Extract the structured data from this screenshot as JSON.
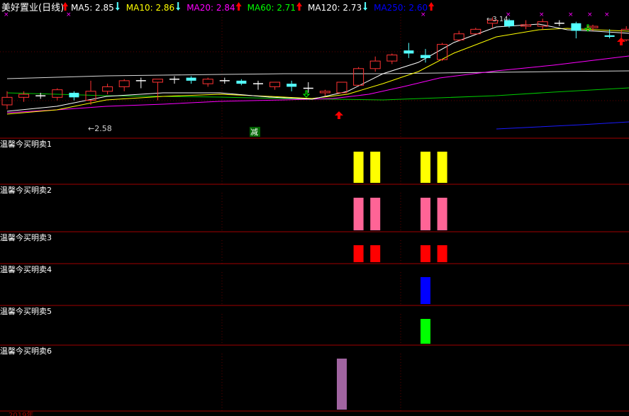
{
  "header": {
    "stock_name": "美好置业(日线)",
    "indicators": [
      {
        "label": "MA5: 2.85",
        "arrow": "down",
        "color": "#ffffff",
        "icon": "arrow-down-icon"
      },
      {
        "label": "MA10: 2.86",
        "arrow": "down",
        "color": "#ffff00",
        "icon": "arrow-down-icon"
      },
      {
        "label": "MA20: 2.84",
        "arrow": "up",
        "color": "#ff00ff",
        "icon": "arrow-up-icon"
      },
      {
        "label": "MA60: 2.71",
        "arrow": "up",
        "color": "#00ff00",
        "icon": "arrow-up-icon"
      },
      {
        "label": "MA120: 2.73",
        "arrow": "down",
        "color": "#ffffff",
        "icon": "arrow-down-icon"
      },
      {
        "label": "MA250: 2.60",
        "arrow": "up",
        "color": "#0000ff",
        "icon": "arrow-up-icon"
      }
    ]
  },
  "colors": {
    "background": "#000000",
    "panel_border": "#a00000",
    "up_candle": "#ff3232",
    "down_candle": "#54ffff",
    "doji": "#ffffff",
    "text": "#ffffff"
  },
  "chart_data": {
    "type": "candlestick",
    "price_range": [
      2.4,
      3.15
    ],
    "candles": [
      {
        "o": 2.55,
        "h": 2.64,
        "l": 2.52,
        "c": 2.6
      },
      {
        "o": 2.6,
        "h": 2.64,
        "l": 2.57,
        "c": 2.62
      },
      {
        "o": 2.61,
        "h": 2.63,
        "l": 2.59,
        "c": 2.61
      },
      {
        "o": 2.6,
        "h": 2.66,
        "l": 2.58,
        "c": 2.65
      },
      {
        "o": 2.63,
        "h": 2.64,
        "l": 2.58,
        "c": 2.6
      },
      {
        "o": 2.58,
        "h": 2.71,
        "l": 2.55,
        "c": 2.64
      },
      {
        "o": 2.64,
        "h": 2.69,
        "l": 2.62,
        "c": 2.67
      },
      {
        "o": 2.67,
        "h": 2.72,
        "l": 2.64,
        "c": 2.71
      },
      {
        "o": 2.71,
        "h": 2.73,
        "l": 2.66,
        "c": 2.71
      },
      {
        "o": 2.7,
        "h": 2.72,
        "l": 2.58,
        "c": 2.72
      },
      {
        "o": 2.72,
        "h": 2.74,
        "l": 2.69,
        "c": 2.72
      },
      {
        "o": 2.73,
        "h": 2.74,
        "l": 2.69,
        "c": 2.71
      },
      {
        "o": 2.69,
        "h": 2.73,
        "l": 2.67,
        "c": 2.72
      },
      {
        "o": 2.71,
        "h": 2.73,
        "l": 2.69,
        "c": 2.71
      },
      {
        "o": 2.71,
        "h": 2.72,
        "l": 2.68,
        "c": 2.69
      },
      {
        "o": 2.69,
        "h": 2.71,
        "l": 2.65,
        "c": 2.69
      },
      {
        "o": 2.67,
        "h": 2.7,
        "l": 2.65,
        "c": 2.7
      },
      {
        "o": 2.69,
        "h": 2.71,
        "l": 2.64,
        "c": 2.67
      },
      {
        "o": 2.66,
        "h": 2.7,
        "l": 2.63,
        "c": 2.66
      },
      {
        "o": 2.63,
        "h": 2.65,
        "l": 2.61,
        "c": 2.64
      },
      {
        "o": 2.63,
        "h": 2.7,
        "l": 2.63,
        "c": 2.7
      },
      {
        "o": 2.68,
        "h": 2.8,
        "l": 2.68,
        "c": 2.79
      },
      {
        "o": 2.79,
        "h": 2.87,
        "l": 2.77,
        "c": 2.84
      },
      {
        "o": 2.84,
        "h": 2.89,
        "l": 2.82,
        "c": 2.88
      },
      {
        "o": 2.91,
        "h": 2.96,
        "l": 2.86,
        "c": 2.89
      },
      {
        "o": 2.88,
        "h": 2.92,
        "l": 2.83,
        "c": 2.86
      },
      {
        "o": 2.85,
        "h": 2.96,
        "l": 2.84,
        "c": 2.95
      },
      {
        "o": 2.98,
        "h": 3.04,
        "l": 2.97,
        "c": 3.02
      },
      {
        "o": 3.02,
        "h": 3.06,
        "l": 3.02,
        "c": 3.05
      },
      {
        "o": 3.09,
        "h": 3.13,
        "l": 3.06,
        "c": 3.11
      },
      {
        "o": 3.11,
        "h": 3.12,
        "l": 3.06,
        "c": 3.07
      },
      {
        "o": 3.07,
        "h": 3.11,
        "l": 3.05,
        "c": 3.08
      },
      {
        "o": 3.07,
        "h": 3.12,
        "l": 3.05,
        "c": 3.1
      },
      {
        "o": 3.09,
        "h": 3.11,
        "l": 3.07,
        "c": 3.09
      },
      {
        "o": 3.09,
        "h": 3.1,
        "l": 2.99,
        "c": 3.04
      },
      {
        "o": 3.06,
        "h": 3.08,
        "l": 3.04,
        "c": 3.07
      },
      {
        "o": 3.01,
        "h": 3.05,
        "l": 2.99,
        "c": 3.0
      },
      {
        "o": 2.98,
        "h": 3.07,
        "l": 2.97,
        "c": 3.05
      },
      {
        "o": 3.05,
        "h": 3.06,
        "l": 3.0,
        "c": 3.06
      }
    ],
    "annotations": {
      "low_label": "←2.58",
      "high_label": "←3.14",
      "tag_label": "减"
    },
    "sub_panels": [
      {
        "label": "温馨今买明卖1",
        "bar_color": "#ffff00",
        "bars": [
          21,
          22,
          25,
          26
        ]
      },
      {
        "label": "温馨今买明卖2",
        "bar_color": "#ff6496",
        "bars": [
          21,
          22,
          25,
          26
        ]
      },
      {
        "label": "温馨今买明卖3",
        "bar_color": "#ff0000",
        "bars": [
          21,
          22,
          25,
          26
        ]
      },
      {
        "label": "温馨今买明卖4",
        "bar_color": "#0000ff",
        "bars": [
          25
        ]
      },
      {
        "label": "温馨今买明卖5",
        "bar_color": "#00ff00",
        "bars": [
          25
        ]
      },
      {
        "label": "温馨今买明卖6",
        "bar_color": "#a064a0",
        "bars": [
          20
        ]
      }
    ],
    "footer_label": "2019年"
  }
}
